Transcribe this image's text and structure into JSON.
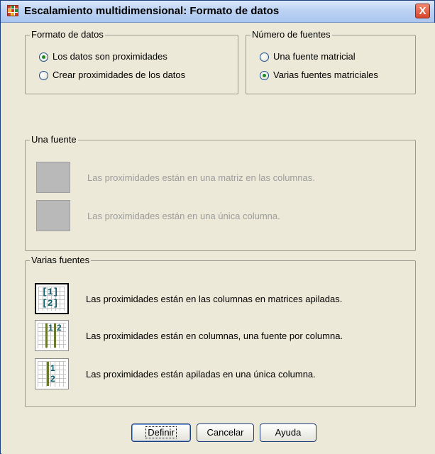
{
  "window": {
    "title": "Escalamiento multidimensional: Formato de datos",
    "close_label": "X"
  },
  "formato": {
    "legend": "Formato de datos",
    "options": [
      {
        "label": "Los datos son proximidades",
        "checked": true
      },
      {
        "label": "Crear proximidades de los datos",
        "checked": false
      }
    ]
  },
  "fuentes": {
    "legend": "Número de fuentes",
    "options": [
      {
        "label": "Una fuente matricial",
        "checked": false
      },
      {
        "label": "Varias fuentes matriciales",
        "checked": true
      }
    ]
  },
  "una_fuente": {
    "legend": "Una fuente",
    "items": [
      {
        "label": "Las proximidades están en una matriz en las columnas."
      },
      {
        "label": "Las proximidades están en una única columna."
      }
    ]
  },
  "varias_fuentes": {
    "legend": "Varias fuentes",
    "items": [
      {
        "label": "Las proximidades están en las columnas en matrices apiladas.",
        "icon_text": [
          "[1]",
          "[2]"
        ]
      },
      {
        "label": "Las proximidades están en columnas, una fuente por columna.",
        "icon_text": [
          "1",
          "2"
        ]
      },
      {
        "label": "Las proximidades están apiladas en una única columna.",
        "icon_text": [
          "1",
          "2"
        ]
      }
    ]
  },
  "buttons": {
    "definir": "Definir",
    "cancelar": "Cancelar",
    "ayuda": "Ayuda"
  }
}
